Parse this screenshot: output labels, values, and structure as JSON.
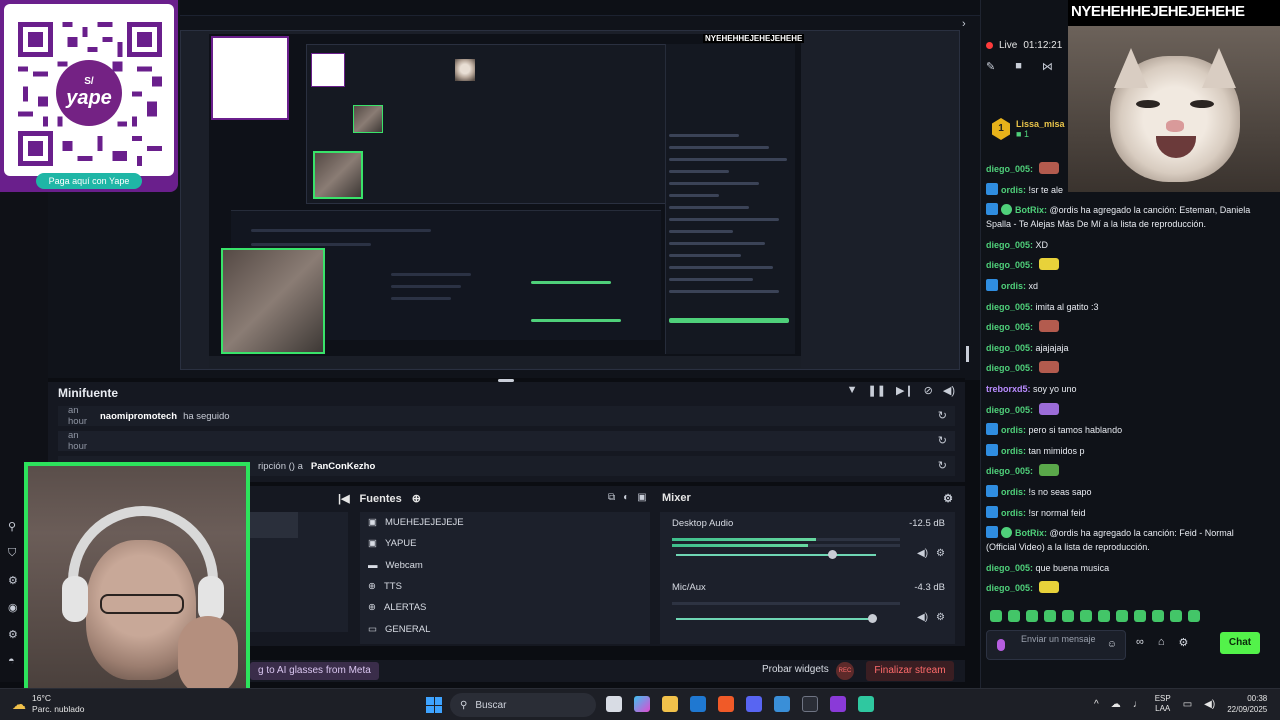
{
  "yape": {
    "logo_text": "yape",
    "logo_currency": "S/",
    "pill_label": "Paga aquí con Yape"
  },
  "overlay_cat": {
    "title": "NYEHEHHEJEHEJEHEHE"
  },
  "minifuente": {
    "title": "Minifuente",
    "events": [
      {
        "time": "an hour",
        "user": "naomipromotech",
        "action": "ha seguido"
      },
      {
        "time": "an hour",
        "user": "",
        "action": ""
      },
      {
        "time": "",
        "user": "PanConKezho",
        "action": "ripción () a"
      }
    ]
  },
  "fuentes": {
    "title": "Fuentes",
    "items": [
      {
        "label": "MUEHEJEJEJEJE",
        "icon": "image-icon"
      },
      {
        "label": "YAPUE",
        "icon": "image-icon"
      },
      {
        "label": "Webcam",
        "icon": "folder-icon"
      },
      {
        "label": "TTS",
        "icon": "globe-icon"
      },
      {
        "label": "ALERTAS",
        "icon": "globe-icon"
      },
      {
        "label": "GENERAL",
        "icon": "monitor-icon"
      }
    ]
  },
  "mixer": {
    "title": "Mixer",
    "channels": [
      {
        "name": "Desktop Audio",
        "db": "-12.5 dB",
        "meter_level": 0.63,
        "volume": 0.78
      },
      {
        "name": "Mic/Aux",
        "db": "-4.3 dB",
        "meter_level": 0.0,
        "volume": 0.98
      }
    ]
  },
  "bottom_bar": {
    "meta_text": "g to AI glasses from Meta",
    "probar_label": "Probar widgets",
    "rec_label": "REC",
    "finalizar_label": "Finalizar stream"
  },
  "chat": {
    "live_label": "Live",
    "live_time": "01:12:21",
    "pinned": {
      "rank": "1",
      "user": "Lissa_misa",
      "count": "1"
    },
    "messages": [
      {
        "user": "diego_005",
        "color": "#4fd07a",
        "text": "",
        "emote": "#b35b4e",
        "bot": false,
        "verified": false
      },
      {
        "user": "ordis",
        "color": "#4fd07a",
        "text": "!sr te ale",
        "emote": "",
        "bot": true,
        "verified": false
      },
      {
        "user": "BotRix",
        "color": "#4fd07a",
        "text": "@ordis ha agregado la canción: Esteman, Daniela Spalla - Te Alejas Más De Mí a la lista de reproducción.",
        "emote": "",
        "bot": true,
        "verified": true
      },
      {
        "user": "diego_005",
        "color": "#4fd07a",
        "text": "XD",
        "emote": "",
        "bot": false,
        "verified": false
      },
      {
        "user": "diego_005",
        "color": "#4fd07a",
        "text": "",
        "emote": "#e8d23a",
        "bot": false,
        "verified": false
      },
      {
        "user": "ordis",
        "color": "#4fd07a",
        "text": "xd",
        "emote": "",
        "bot": true,
        "verified": false
      },
      {
        "user": "diego_005",
        "color": "#4fd07a",
        "text": "imita al gatito :3",
        "emote": "",
        "bot": false,
        "verified": false
      },
      {
        "user": "diego_005",
        "color": "#4fd07a",
        "text": "",
        "emote": "#b35b4e",
        "bot": false,
        "verified": false
      },
      {
        "user": "diego_005",
        "color": "#4fd07a",
        "text": "ajajajaja",
        "emote": "",
        "bot": false,
        "verified": false
      },
      {
        "user": "diego_005",
        "color": "#4fd07a",
        "text": "",
        "emote": "#b35b4e",
        "bot": false,
        "verified": false
      },
      {
        "user": "treborxd5",
        "color": "#b98cff",
        "text": "soy yo uno",
        "emote": "",
        "bot": false,
        "verified": false
      },
      {
        "user": "diego_005",
        "color": "#4fd07a",
        "text": "",
        "emote": "#9b6cd8",
        "bot": false,
        "verified": false
      },
      {
        "user": "ordis",
        "color": "#4fd07a",
        "text": "pero si tamos hablando",
        "emote": "",
        "bot": true,
        "verified": false
      },
      {
        "user": "ordis",
        "color": "#4fd07a",
        "text": "tan mimidos p",
        "emote": "",
        "bot": true,
        "verified": false
      },
      {
        "user": "diego_005",
        "color": "#4fd07a",
        "text": "",
        "emote": "#5aa84a",
        "bot": false,
        "verified": false
      },
      {
        "user": "ordis",
        "color": "#4fd07a",
        "text": "!s no seas sapo",
        "emote": "",
        "bot": true,
        "verified": false
      },
      {
        "user": "ordis",
        "color": "#4fd07a",
        "text": "!sr normal feid",
        "emote": "",
        "bot": true,
        "verified": false
      },
      {
        "user": "BotRix",
        "color": "#4fd07a",
        "text": "@ordis ha agregado la canción: Feid - Normal (Official Video) a la lista de reproducción.",
        "emote": "",
        "bot": true,
        "verified": true
      },
      {
        "user": "diego_005",
        "color": "#4fd07a",
        "text": "que buena musica",
        "emote": "",
        "bot": false,
        "verified": false
      },
      {
        "user": "diego_005",
        "color": "#4fd07a",
        "text": "",
        "emote": "#e8d23a",
        "bot": false,
        "verified": false
      }
    ],
    "input_placeholder": "Enviar un mensaje",
    "send_label": "Chat"
  },
  "taskbar": {
    "weather_temp": "16°C",
    "weather_desc": "Parc. nublado",
    "search_label": "Buscar",
    "lang_1": "ESP",
    "lang_2": "LAA",
    "time": "00:38",
    "date": "22/09/2025"
  },
  "colors": {
    "accent_green": "#53f24a",
    "webcam_border": "#2de35c",
    "yape_purple": "#6a1f8c",
    "stop_red": "#ff6b6b"
  }
}
